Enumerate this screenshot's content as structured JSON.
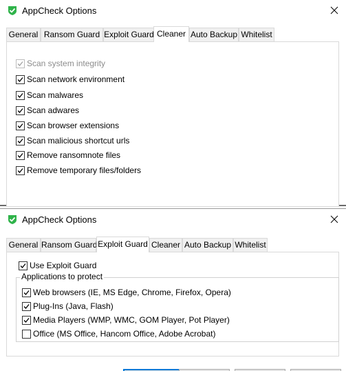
{
  "top_window": {
    "title": "AppCheck Options",
    "tabs": [
      {
        "label": "General"
      },
      {
        "label": "Ransom Guard"
      },
      {
        "label": "Exploit Guard"
      },
      {
        "label": "Cleaner"
      },
      {
        "label": "Auto Backup"
      },
      {
        "label": "Whitelist"
      }
    ],
    "active_tab": "Cleaner",
    "options": [
      {
        "label": "Scan system integrity",
        "checked": true,
        "disabled": true
      },
      {
        "label": "Scan network environment",
        "checked": true
      },
      {
        "label": "Scan malwares",
        "checked": true
      },
      {
        "label": "Scan adwares",
        "checked": true
      },
      {
        "label": "Scan browser extensions",
        "checked": true
      },
      {
        "label": "Scan malicious shortcut urls",
        "checked": true
      },
      {
        "label": "Remove ransomnote files",
        "checked": true
      },
      {
        "label": "Remove temporary files/folders",
        "checked": true
      }
    ]
  },
  "bottom_window": {
    "title": "AppCheck Options",
    "tabs": [
      {
        "label": "General"
      },
      {
        "label": "Ransom Guard"
      },
      {
        "label": "Exploit Guard"
      },
      {
        "label": "Cleaner"
      },
      {
        "label": "Auto Backup"
      },
      {
        "label": "Whitelist"
      }
    ],
    "active_tab": "Exploit Guard",
    "use_exploit_guard": {
      "label": "Use Exploit Guard",
      "checked": true
    },
    "group_title": "Applications to protect",
    "applications": [
      {
        "label": "Web browsers (IE, MS Edge, Chrome, Firefox, Opera)",
        "checked": true
      },
      {
        "label": "Plug-Ins (Java, Flash)",
        "checked": true
      },
      {
        "label": "Media Players (WMP, WMC, GOM Player, Pot Player)",
        "checked": true
      },
      {
        "label": "Office (MS Office, Hancom Office, Adobe Acrobat)",
        "checked": false
      }
    ]
  },
  "colors": {
    "accent_green": "#2fb34a",
    "focus_blue": "#0078d7"
  },
  "icons": {
    "app": "appcheck-shield-icon",
    "close": "close-icon",
    "check": "checkmark-icon"
  }
}
